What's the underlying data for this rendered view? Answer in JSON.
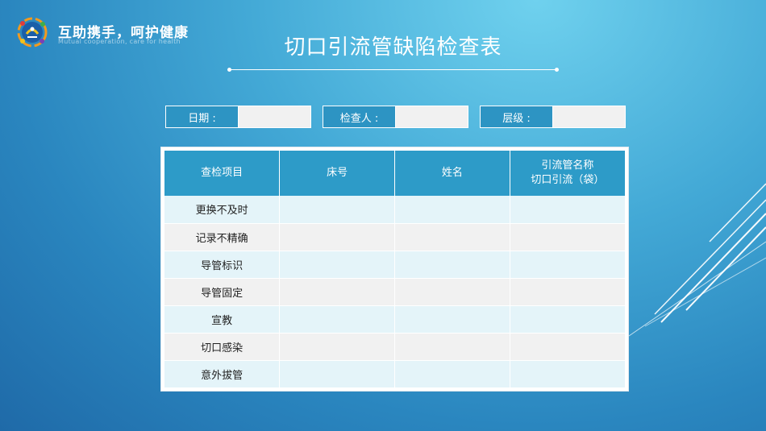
{
  "brand": {
    "title": "互助携手，呵护健康",
    "subtitle": "Mutual cooperation, care for health"
  },
  "page_title": "切口引流管缺陷检查表",
  "fields": [
    {
      "label": "日期 :",
      "value": ""
    },
    {
      "label": "检查人 :",
      "value": ""
    },
    {
      "label": "层级 :",
      "value": ""
    }
  ],
  "table": {
    "headers": [
      {
        "lines": [
          "查检项目"
        ]
      },
      {
        "lines": [
          "床号"
        ]
      },
      {
        "lines": [
          "姓名"
        ]
      },
      {
        "lines": [
          "引流管名称",
          "切口引流（袋）"
        ]
      }
    ],
    "rows": [
      [
        "更换不及时",
        "",
        "",
        ""
      ],
      [
        "记录不精确",
        "",
        "",
        ""
      ],
      [
        "导管标识",
        "",
        "",
        ""
      ],
      [
        "导管固定",
        "",
        "",
        ""
      ],
      [
        "宣教",
        "",
        "",
        ""
      ],
      [
        "切口感染",
        "",
        "",
        ""
      ],
      [
        "意外拔管",
        "",
        "",
        ""
      ]
    ]
  },
  "colors": {
    "background": "#43a9d6",
    "header_fill": "#2d9bc8",
    "row_tint": "#e4f4f9",
    "row_gray": "#f1f1f1"
  }
}
